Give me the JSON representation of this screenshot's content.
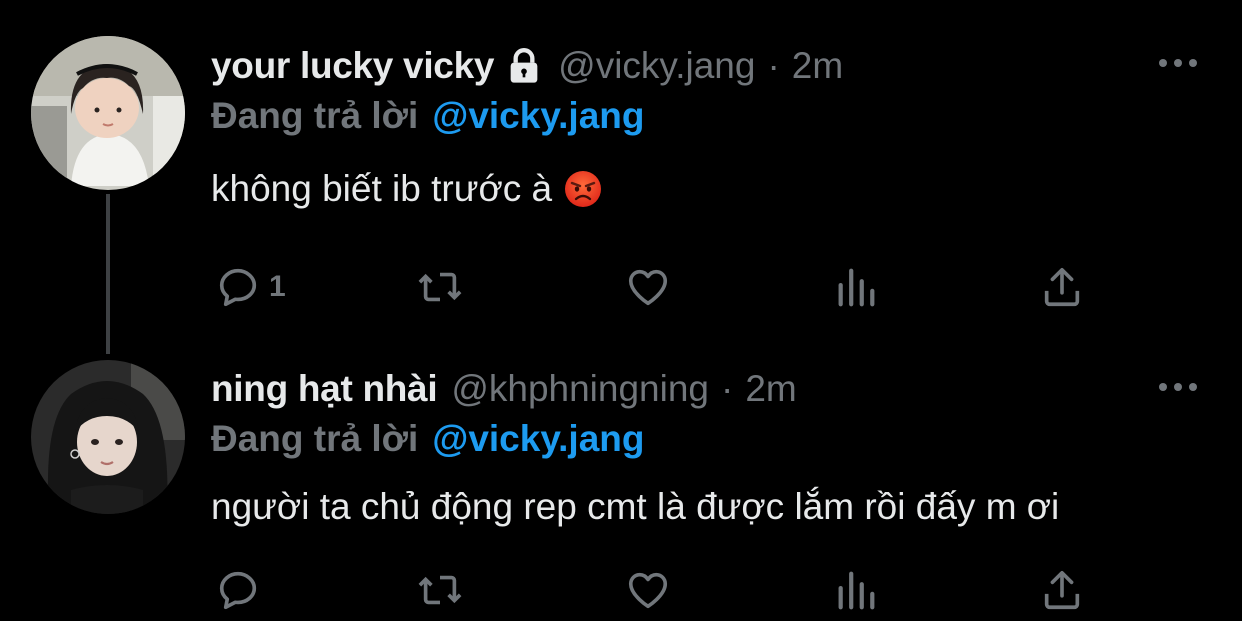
{
  "tweets": [
    {
      "display_name": "your lucky vicky",
      "protected": true,
      "handle": "@vicky.jang",
      "separator": "·",
      "time": "2m",
      "reply_prefix": "Đang trả lời",
      "reply_to": "@vicky.jang",
      "text": "không biết ib trước à",
      "emoji": "angry-face",
      "reply_count": "1",
      "retweet_count": "",
      "like_count": "",
      "view_count": ""
    },
    {
      "display_name": "ning hạt nhài",
      "protected": false,
      "handle": "@khphningning",
      "separator": "·",
      "time": "2m",
      "reply_prefix": "Đang trả lời",
      "reply_to": "@vicky.jang",
      "text": "người ta chủ động rep cmt là được lắm rồi đấy m ơi",
      "reply_count": "",
      "retweet_count": "",
      "like_count": "",
      "view_count": ""
    }
  ],
  "icons": {
    "lock": "lock-icon",
    "more": "more-icon",
    "reply": "reply-icon",
    "retweet": "retweet-icon",
    "like": "heart-icon",
    "views": "views-icon",
    "share": "share-icon"
  },
  "colors": {
    "background": "#000000",
    "primary_text": "#e7e9ea",
    "secondary_text": "#71767b",
    "mention": "#1d9bf0",
    "thread_line": "#3e4144"
  }
}
